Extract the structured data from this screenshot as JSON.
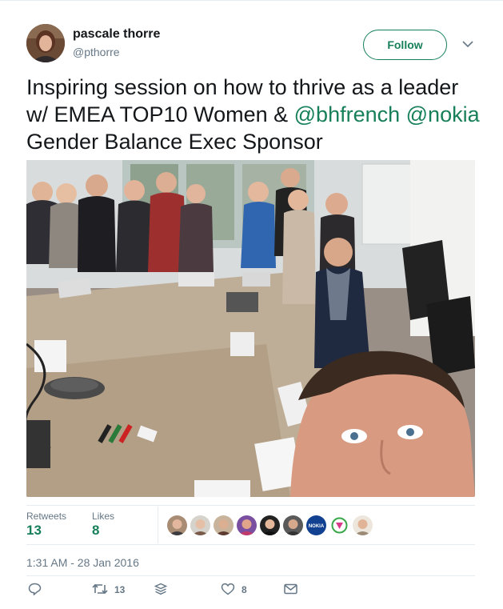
{
  "author": {
    "display_name": "pascale thorre",
    "handle": "@pthorre"
  },
  "follow_label": "Follow",
  "tweet": {
    "text_part1": "Inspiring session on how to thrive as a leader w/ EMEA TOP10 Women & ",
    "mention_1": "@bhfrench",
    "mention_2": "@nokia",
    "text_part2": " Gender Balance Exec Sponsor"
  },
  "stats": {
    "retweets_label": "Retweets",
    "retweets_value": "13",
    "likes_label": "Likes",
    "likes_value": "8",
    "liker_badge_text": "NOKIA"
  },
  "timestamp": "1:31 AM - 28 Jan 2016",
  "actions": {
    "retweet_count": "13",
    "like_count": "8"
  },
  "colors": {
    "accent": "#17805a",
    "muted": "#657786",
    "text": "#14171a"
  },
  "icons": [
    "caret-down-icon",
    "reply-icon",
    "retweet-icon",
    "stack-icon",
    "heart-icon",
    "envelope-icon"
  ]
}
